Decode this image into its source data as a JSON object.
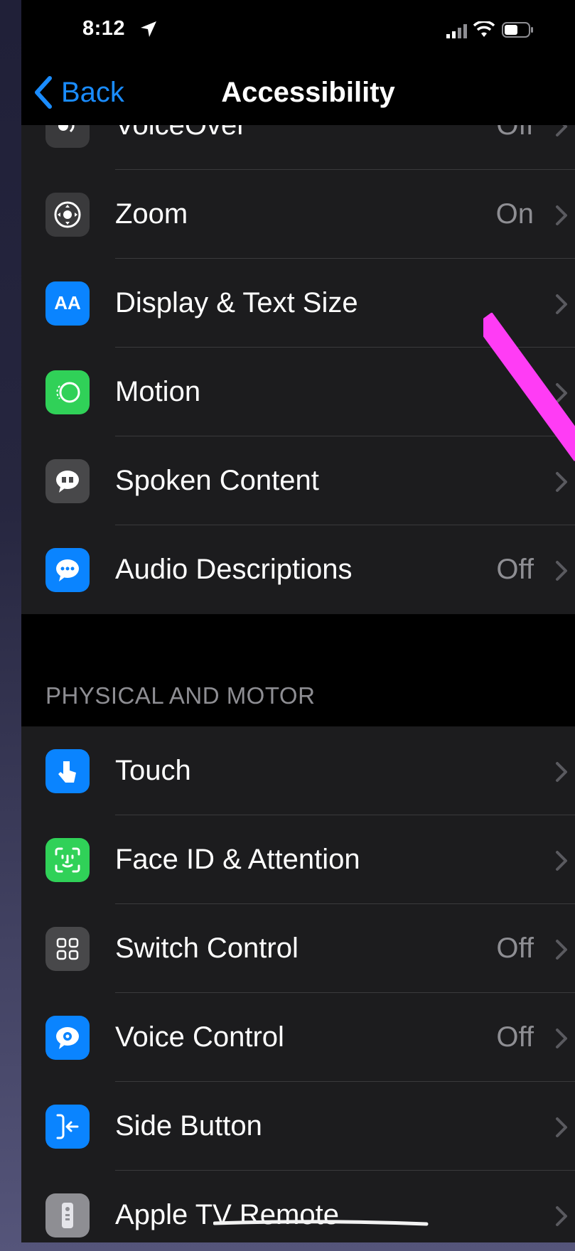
{
  "status_bar": {
    "time": "8:12"
  },
  "nav": {
    "back_label": "Back",
    "title": "Accessibility"
  },
  "vision_rows": [
    {
      "label": "VoiceOver",
      "value": "Off",
      "icon": "voiceover-icon",
      "color": "#3a3a3c"
    },
    {
      "label": "Zoom",
      "value": "On",
      "icon": "zoom-icon",
      "color": "#3a3a3c"
    },
    {
      "label": "Display & Text Size",
      "value": "",
      "icon": "display-text-size-icon",
      "color": "#0a84ff",
      "icon_text": "AA"
    },
    {
      "label": "Motion",
      "value": "",
      "icon": "motion-icon",
      "color": "#30d158"
    },
    {
      "label": "Spoken Content",
      "value": "",
      "icon": "spoken-content-icon",
      "color": "#48484a"
    },
    {
      "label": "Audio Descriptions",
      "value": "Off",
      "icon": "audio-descriptions-icon",
      "color": "#0a84ff"
    }
  ],
  "section_physical": {
    "header": "PHYSICAL AND MOTOR"
  },
  "physical_rows": [
    {
      "label": "Touch",
      "value": "",
      "icon": "touch-icon",
      "color": "#0a84ff"
    },
    {
      "label": "Face ID & Attention",
      "value": "",
      "icon": "face-id-icon",
      "color": "#30d158"
    },
    {
      "label": "Switch Control",
      "value": "Off",
      "icon": "switch-control-icon",
      "color": "#48484a"
    },
    {
      "label": "Voice Control",
      "value": "Off",
      "icon": "voice-control-icon",
      "color": "#0a84ff"
    },
    {
      "label": "Side Button",
      "value": "",
      "icon": "side-button-icon",
      "color": "#0a84ff"
    },
    {
      "label": "Apple TV Remote",
      "value": "",
      "icon": "apple-tv-remote-icon",
      "color": "#8e8e93"
    }
  ],
  "colors": {
    "accent": "#0a84ff",
    "annotation": "#ff3cf5"
  }
}
